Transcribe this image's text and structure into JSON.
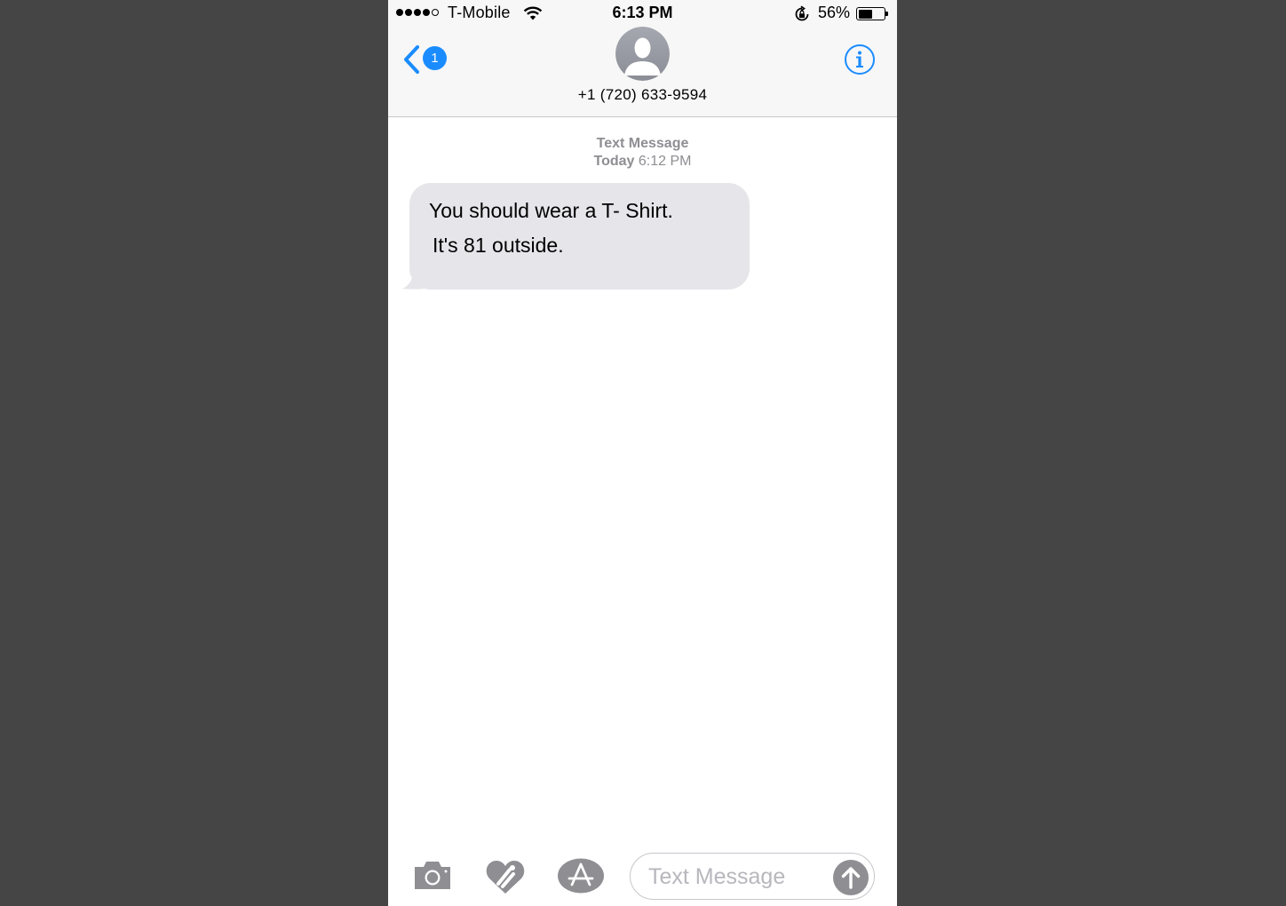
{
  "status_bar": {
    "signal_bars_filled": 4,
    "signal_bars_total": 5,
    "carrier": "T-Mobile",
    "time": "6:13 PM",
    "battery_percent": "56%",
    "battery_level": 0.56,
    "icons": [
      "wifi-icon",
      "rotation-lock-icon",
      "battery-icon"
    ]
  },
  "header": {
    "back_badge": "1",
    "contact_name": "+1 (720) 633-9594",
    "icons": [
      "back-chevron-icon",
      "contact-avatar-icon",
      "info-icon"
    ]
  },
  "conversation": {
    "service_label": "Text Message",
    "date_day": "Today",
    "date_time": "6:12 PM",
    "messages": [
      {
        "direction": "incoming",
        "lines": [
          "You should wear a T- Shirt.",
          "It's 81 outside."
        ]
      }
    ]
  },
  "input_bar": {
    "placeholder": "Text Message",
    "value": "",
    "icons": [
      "camera-icon",
      "digital-touch-icon",
      "app-store-icon",
      "send-arrow-icon"
    ]
  },
  "colors": {
    "accent_blue": "#1a8cff",
    "incoming_bubble": "#e5e5ea",
    "bar_background": "#f7f7f7",
    "secondary_text": "#8e8e93",
    "backdrop": "#454545"
  }
}
